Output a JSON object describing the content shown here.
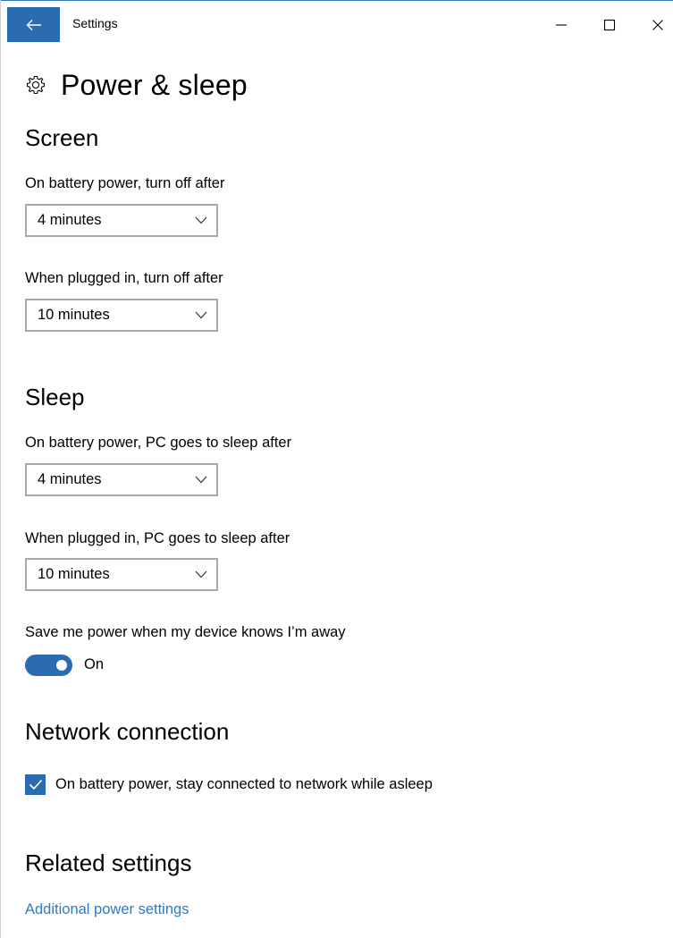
{
  "window": {
    "title": "Settings"
  },
  "page": {
    "title": "Power & sleep"
  },
  "screen": {
    "heading": "Screen",
    "battery_label": "On battery power, turn off after",
    "battery_value": "4 minutes",
    "plugged_label": "When plugged in, turn off after",
    "plugged_value": "10 minutes"
  },
  "sleep": {
    "heading": "Sleep",
    "battery_label": "On battery power, PC goes to sleep after",
    "battery_value": "4 minutes",
    "plugged_label": "When plugged in, PC goes to sleep after",
    "plugged_value": "10 minutes",
    "away_label": "Save me power when my device knows I’m away",
    "away_toggle_state": "On"
  },
  "network": {
    "heading": "Network connection",
    "checkbox_label": "On battery power, stay connected to network while asleep",
    "checkbox_checked": true
  },
  "related": {
    "heading": "Related settings",
    "link_label": "Additional power settings"
  },
  "icons": {
    "back": "back-arrow-icon",
    "minimize": "minimize-icon",
    "maximize": "maximize-icon",
    "close": "close-icon",
    "page": "gear-icon",
    "dropdown": "chevron-down-icon",
    "check": "checkmark-icon"
  },
  "colors": {
    "accent": "#2b6cb0",
    "link": "#2b7cc8",
    "dropdown_border": "#a8a8a8"
  }
}
